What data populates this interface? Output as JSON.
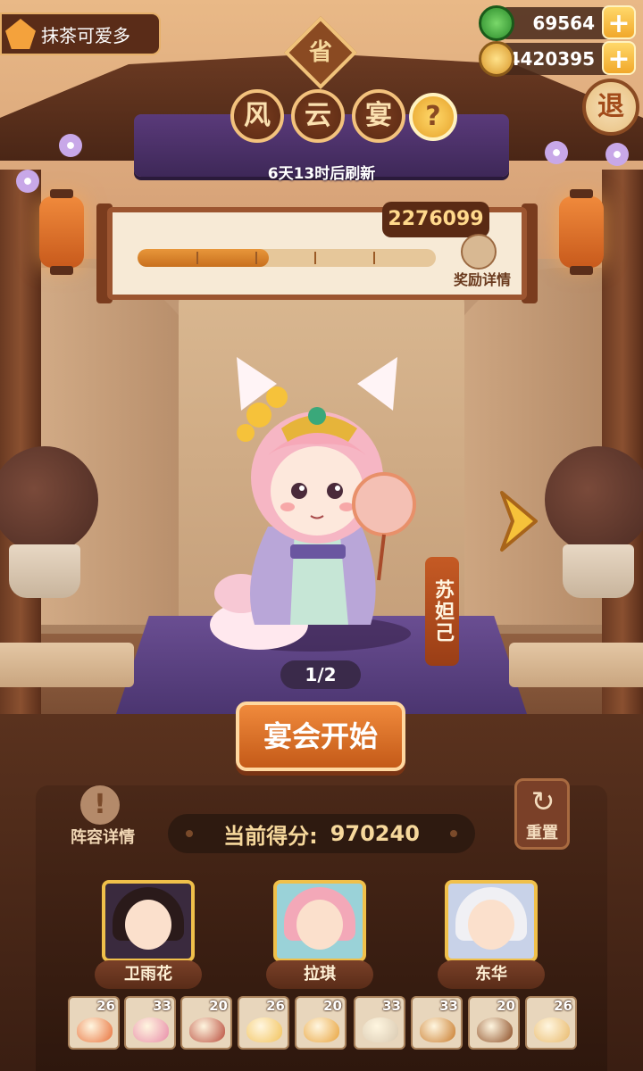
{
  "player": {
    "name": "抹茶可爱多"
  },
  "currencies": [
    {
      "icon": "jade-coin-icon",
      "value": "69564",
      "color": "#3aa83a"
    },
    {
      "icon": "gold-coin-icon",
      "value": "4420395",
      "color": "#f0b43a"
    }
  ],
  "exit_label": "退",
  "province_badge": "省",
  "title_chars": [
    "风",
    "云",
    "宴"
  ],
  "help_label": "?",
  "refresh_text": "6天13时后刷新",
  "progress": {
    "target_score": "2276099",
    "fraction": 0.44,
    "reward_label": "奖励详情"
  },
  "character": {
    "name": "苏妲己",
    "page": "1/2"
  },
  "start_button": "宴会开始",
  "lineup_label": "阵容详情",
  "reset_label": "重置",
  "score": {
    "label": "当前得分:",
    "value": "970240"
  },
  "heroes": [
    {
      "name": "卫雨花",
      "bg": "#3a2a3e",
      "hair": "#2a1a1a"
    },
    {
      "name": "拉琪",
      "bg": "#9ad2d8",
      "hair": "#f3a8b8"
    },
    {
      "name": "东华",
      "bg": "#c8d2e8",
      "hair": "#f0f0f4"
    }
  ],
  "dishes": [
    {
      "count": "26",
      "color": "#e8703a"
    },
    {
      "count": "33",
      "color": "#e88aa8"
    },
    {
      "count": "20",
      "color": "#b84a3a"
    },
    {
      "count": "26",
      "color": "#f2c25a"
    },
    {
      "count": "20",
      "color": "#e8a23a"
    },
    {
      "count": "33",
      "color": "#d8c8b0"
    },
    {
      "count": "33",
      "color": "#c87a2a"
    },
    {
      "count": "20",
      "color": "#8a4a22"
    },
    {
      "count": "26",
      "color": "#e8b86a"
    }
  ]
}
